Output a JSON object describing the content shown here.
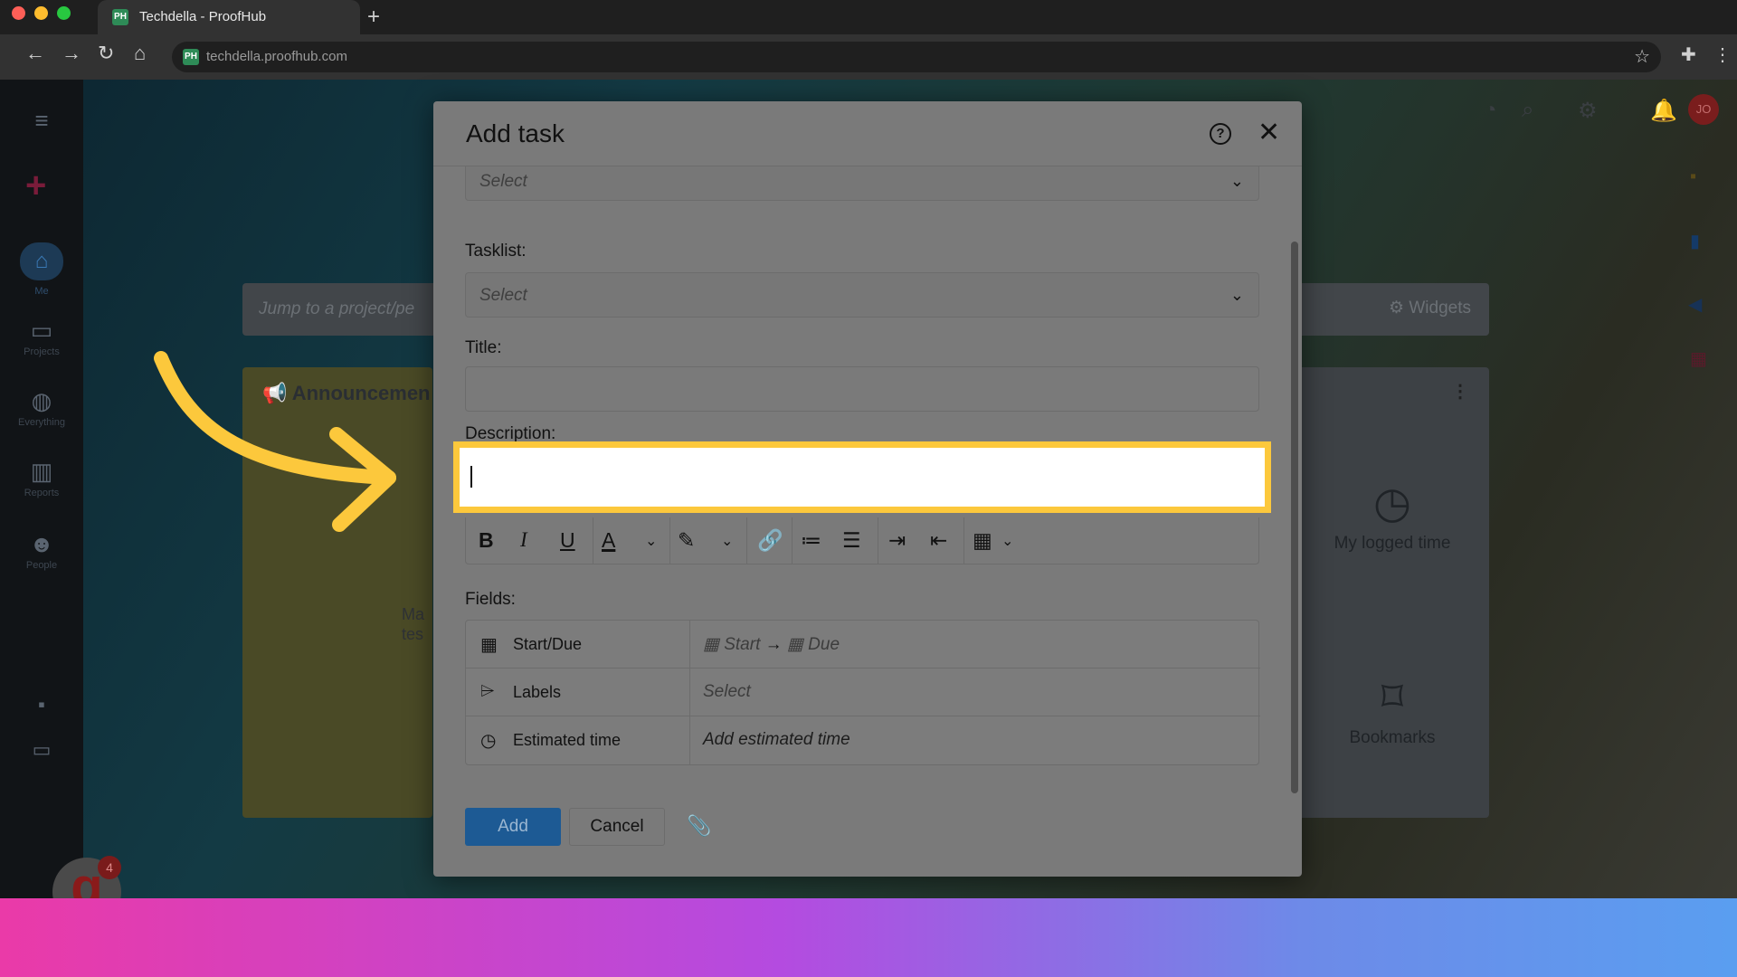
{
  "browser": {
    "tab_title": "Techdella - ProofHub",
    "favicon_text": "PH",
    "url": "techdella.proofhub.com",
    "new_tab": "+",
    "traffic_colors": [
      "#fe5f57",
      "#febc2e",
      "#28c840"
    ]
  },
  "app": {
    "jump_placeholder": "Jump to a project/pe",
    "widgets_label": "Widgets",
    "announcement_title": "Announcemen",
    "announcement_body": [
      "Ma",
      "tes"
    ],
    "tiles": {
      "logged_time": "My logged time",
      "bookmarks": "Bookmarks"
    },
    "avatar_initials": "JO",
    "notification_count": "4",
    "g_letter": "g",
    "rail_items": [
      "Me",
      "Projects",
      "Everything",
      "Reports",
      "People"
    ]
  },
  "modal": {
    "title": "Add task",
    "top_select_placeholder": "Select",
    "tasklist_label": "Tasklist:",
    "tasklist_placeholder": "Select",
    "title_label": "Title:",
    "title_value": "",
    "description_label": "Description:",
    "description_value": "",
    "fields_label": "Fields:",
    "fields": [
      {
        "name": "Start/Due",
        "icon": "calendar-icon",
        "start": "Start",
        "arrow": "→",
        "due": "Due"
      },
      {
        "name": "Labels",
        "icon": "tag-icon",
        "value": "Select"
      },
      {
        "name": "Estimated time",
        "icon": "clock-icon",
        "value": "Add estimated time"
      }
    ],
    "add_label": "Add",
    "cancel_label": "Cancel"
  },
  "colors": {
    "highlight": "#fcc83c",
    "primary_button": "#1d5a94",
    "arrow": "#fcc83c"
  }
}
